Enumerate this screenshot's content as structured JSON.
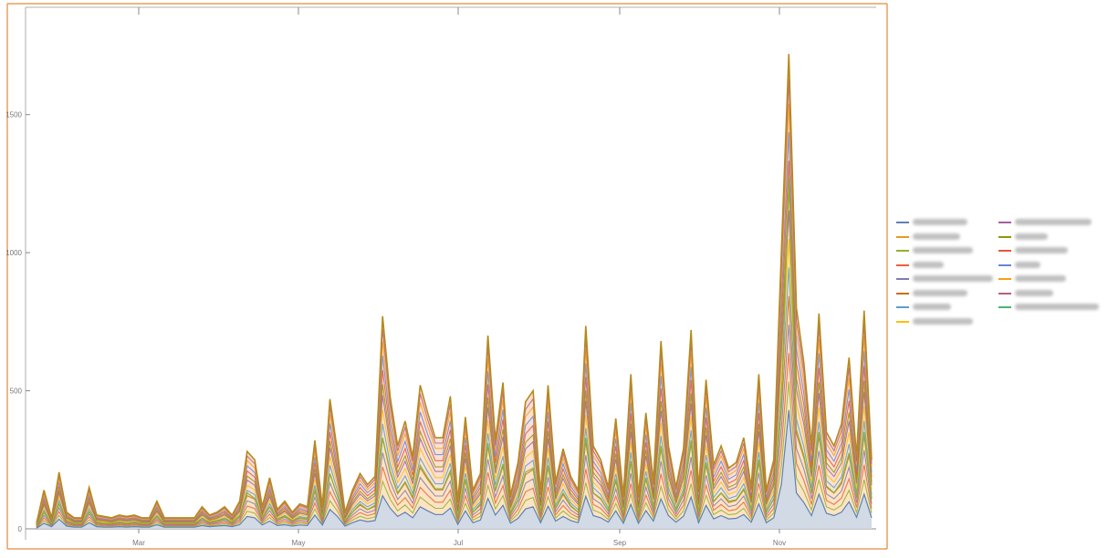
{
  "chart_data": {
    "type": "area",
    "title": "",
    "xlabel": "",
    "ylabel": "",
    "x_ticks": [
      "Mar",
      "May",
      "Jul",
      "Sep",
      "Nov"
    ],
    "y_ticks": [
      0,
      500,
      1000,
      1500
    ],
    "ylim": [
      0,
      1750
    ],
    "grid": false,
    "legend_position": "right",
    "note": "",
    "series_colors": [
      "#5e81b5",
      "#e19c24",
      "#8fb032",
      "#eb6235",
      "#8778b3",
      "#c56e1a",
      "#5d9ec7",
      "#ffbf00",
      "#a5609d",
      "#929600",
      "#e95536",
      "#6685d9",
      "#f89f13",
      "#bc5b80",
      "#47b66d"
    ],
    "upper_envelope": [
      20,
      140,
      40,
      205,
      60,
      40,
      40,
      150,
      50,
      45,
      40,
      50,
      45,
      50,
      40,
      40,
      100,
      40,
      40,
      40,
      40,
      40,
      80,
      50,
      60,
      80,
      50,
      100,
      280,
      250,
      80,
      185,
      70,
      100,
      60,
      90,
      80,
      320,
      80,
      470,
      280,
      60,
      140,
      200,
      160,
      190,
      770,
      480,
      300,
      390,
      260,
      520,
      420,
      330,
      330,
      480,
      100,
      405,
      140,
      200,
      700,
      320,
      530,
      120,
      240,
      460,
      500,
      130,
      520,
      170,
      290,
      190,
      140,
      735,
      300,
      250,
      150,
      400,
      120,
      560,
      120,
      420,
      170,
      680,
      300,
      150,
      290,
      720,
      140,
      540,
      230,
      300,
      220,
      240,
      330,
      150,
      560,
      140,
      250,
      1000,
      1720,
      800,
      600,
      300,
      780,
      350,
      300,
      380,
      620,
      260,
      790,
      250
    ],
    "stacked_mid": [
      10,
      60,
      20,
      90,
      30,
      20,
      20,
      60,
      25,
      20,
      20,
      25,
      20,
      25,
      20,
      20,
      45,
      20,
      20,
      20,
      20,
      20,
      35,
      25,
      30,
      35,
      25,
      45,
      130,
      110,
      40,
      80,
      35,
      45,
      30,
      40,
      35,
      140,
      40,
      200,
      120,
      30,
      60,
      90,
      70,
      85,
      330,
      210,
      130,
      170,
      115,
      230,
      185,
      145,
      145,
      210,
      45,
      180,
      60,
      90,
      310,
      140,
      235,
      55,
      105,
      205,
      220,
      60,
      230,
      75,
      130,
      85,
      60,
      330,
      130,
      110,
      65,
      180,
      55,
      245,
      55,
      185,
      75,
      300,
      130,
      65,
      130,
      320,
      60,
      240,
      100,
      130,
      100,
      105,
      145,
      65,
      250,
      60,
      110,
      440,
      1270,
      360,
      265,
      130,
      350,
      155,
      130,
      170,
      275,
      115,
      350,
      110
    ],
    "base_series": [
      2,
      20,
      8,
      35,
      10,
      6,
      6,
      22,
      8,
      6,
      6,
      8,
      6,
      8,
      6,
      6,
      15,
      6,
      6,
      6,
      6,
      6,
      12,
      8,
      10,
      12,
      8,
      15,
      45,
      40,
      14,
      28,
      12,
      15,
      10,
      14,
      12,
      50,
      14,
      70,
      45,
      10,
      22,
      32,
      26,
      30,
      120,
      75,
      45,
      60,
      40,
      80,
      65,
      52,
      52,
      75,
      16,
      65,
      22,
      32,
      110,
      50,
      85,
      20,
      38,
      72,
      80,
      22,
      82,
      28,
      45,
      30,
      22,
      118,
      48,
      40,
      24,
      65,
      20,
      88,
      20,
      66,
      28,
      108,
      48,
      24,
      46,
      115,
      22,
      85,
      36,
      48,
      36,
      38,
      52,
      24,
      90,
      22,
      40,
      160,
      430,
      130,
      95,
      48,
      125,
      56,
      48,
      60,
      98,
      42,
      125,
      40
    ]
  },
  "legend": {
    "entries": [
      {
        "color": "#5e81b5"
      },
      {
        "color": "#e19c24"
      },
      {
        "color": "#8fb032"
      },
      {
        "color": "#eb6235"
      },
      {
        "color": "#8778b3"
      },
      {
        "color": "#c56e1a"
      },
      {
        "color": "#5d9ec7"
      },
      {
        "color": "#ffbf00"
      },
      {
        "color": "#a5609d"
      },
      {
        "color": "#929600"
      },
      {
        "color": "#e95536"
      },
      {
        "color": "#6685d9"
      },
      {
        "color": "#f89f13"
      },
      {
        "color": "#bc5b80"
      },
      {
        "color": "#47b66d"
      }
    ]
  }
}
